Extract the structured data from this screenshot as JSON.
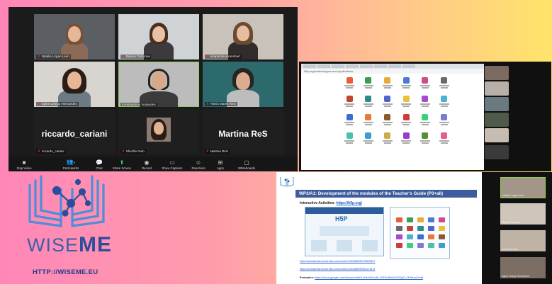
{
  "zoom_gallery": {
    "participants": [
      {
        "name": "Natalia Lirgan Leon",
        "video": true
      },
      {
        "name": "Diyana Todorova",
        "video": true
      },
      {
        "name": "anapesteixeira/Albert",
        "video": true
      },
      {
        "name": "Eglee Letego Hernandes",
        "video": true
      },
      {
        "name": "Konstantinos Voukystes",
        "video": true
      },
      {
        "name": "Alexis Marek ReS",
        "video": true
      },
      {
        "name": "riccardo_cariani",
        "video": false
      },
      {
        "name": "Sherifie Noto",
        "video": true
      },
      {
        "name": "Martina ReS",
        "video": false
      }
    ],
    "toolbar": [
      {
        "label": "Stop Video",
        "icon": "video-camera-icon"
      },
      {
        "label": "Participants",
        "icon": "participants-icon",
        "count": "9"
      },
      {
        "label": "Chat",
        "icon": "chat-icon"
      },
      {
        "label": "Share Screen",
        "icon": "share-screen-icon"
      },
      {
        "label": "Record",
        "icon": "record-icon"
      },
      {
        "label": "Show Captions",
        "icon": "captions-icon"
      },
      {
        "label": "Reactions",
        "icon": "reactions-icon"
      },
      {
        "label": "Apps",
        "icon": "apps-icon"
      },
      {
        "label": "Whiteboards",
        "icon": "whiteboard-icon"
      }
    ]
  },
  "browser_share": {
    "address": "h5p.org/content-types-and-applications",
    "app_colors": [
      "#e85c3a",
      "#3a9e4f",
      "#e8a93a",
      "#4a7bd1",
      "#d14a88",
      "#6a6a6a",
      "#c2452d",
      "#2b8c8c",
      "#5563c7",
      "#e8c23a",
      "#a84ad1",
      "#4ab3d1",
      "#3a6fd1",
      "#e87b3a",
      "#8c5a2b",
      "#d13a3a",
      "#3ad17b",
      "#7b7bd1",
      "#4ac2a8",
      "#3a9ed1",
      "#d1a84a",
      "#9c3ad1",
      "#5a8c3a",
      "#e85c8c"
    ]
  },
  "logo": {
    "brand_prefix": "WISE",
    "brand_suffix": "ME",
    "url": "HTTP://WISEME.EU"
  },
  "presentation": {
    "title": "WP3/A1: Development of the modules of the Teacher's Guide (P3+all)",
    "interactive_label": "Interactive Activities: ",
    "interactive_link": "https://h5p.org/",
    "h5p_logo": "H5P",
    "links": [
      "https://formativeforumnet.h5p.com/content/1292486999475635807",
      "https://formativeforumnet.h5p.com/content/1292486999920173472"
    ],
    "examples_label": "Examples: ",
    "examples_link": "https://docs.google.com/document/d/1xHsVvfHuHk-4ODKaEaVuC5QqCr-f1Wem4/edit",
    "cams": [
      "Natalia Lirgan Leon",
      "Diyana Todorova",
      "anapesteixeira",
      "Eglee Letego Hernandes"
    ]
  }
}
